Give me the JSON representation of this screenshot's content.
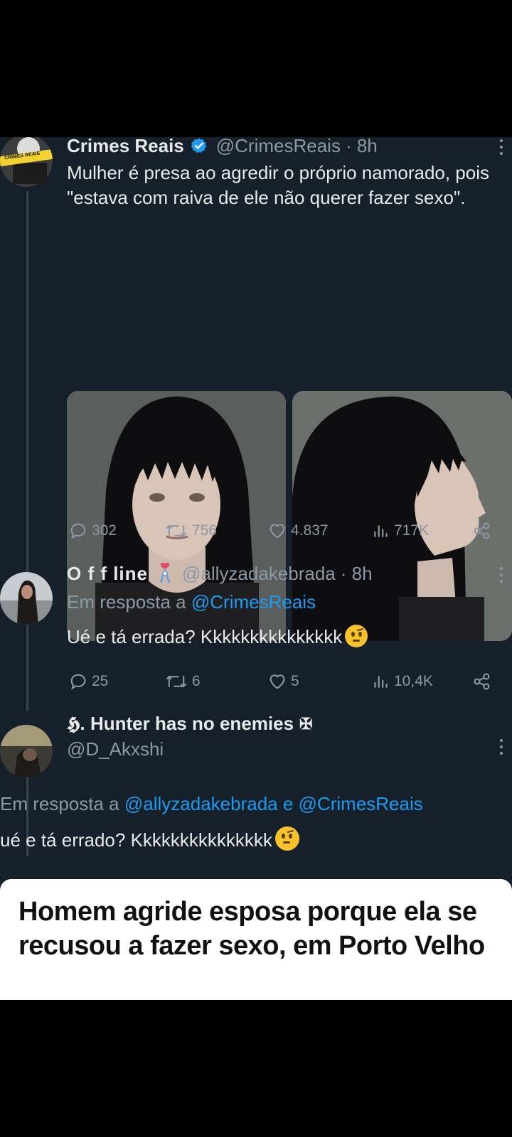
{
  "tweet": {
    "author": "Crimes Reais",
    "handle": "@CrimesReais",
    "time": "· 8h",
    "text": "Mulher é presa ao agredir o próprio namorado, pois \"estava com raiva de ele não querer fazer sexo\".",
    "avatar_label": "CRIMES REAIS",
    "stats": {
      "replies": "302",
      "retweets": "756",
      "likes": "4.837",
      "views": "717K"
    }
  },
  "reply1": {
    "author": "O f f line",
    "handle": "@allyzadakebrada",
    "time": "· 8h",
    "reply_prefix": "Em resposta a",
    "reply_to": "@CrimesReais",
    "text": "Ué e tá errada? Kkkkkkkkkkkkkkk",
    "stats": {
      "replies": "25",
      "retweets": "6",
      "likes": "5",
      "views": "10,4K"
    }
  },
  "reply2": {
    "author": "𝕳. Hunter has no enemies",
    "author_suffix": "✠",
    "handle": "@D_Akxshi",
    "reply_prefix": "Em resposta a",
    "reply_to_1": "@allyzadakebrada",
    "reply_and": "e",
    "reply_to_2": "@CrimesReais",
    "text": "ué e tá errado? Kkkkkkkkkkkkkkk"
  },
  "news": {
    "headline": "Homem agride esposa porque ela se recusou a fazer sexo, em Porto Velho"
  },
  "colors": {
    "background": "#15202b",
    "text": "#e7e9ea",
    "secondary": "#8b98a5",
    "link": "#1d9bf0",
    "verified": "#1d9bf0"
  },
  "icons": [
    "verified-icon",
    "more-icon",
    "reply-icon",
    "retweet-icon",
    "like-icon",
    "views-icon",
    "share-icon",
    "raised-eyebrow-emoji-icon"
  ]
}
